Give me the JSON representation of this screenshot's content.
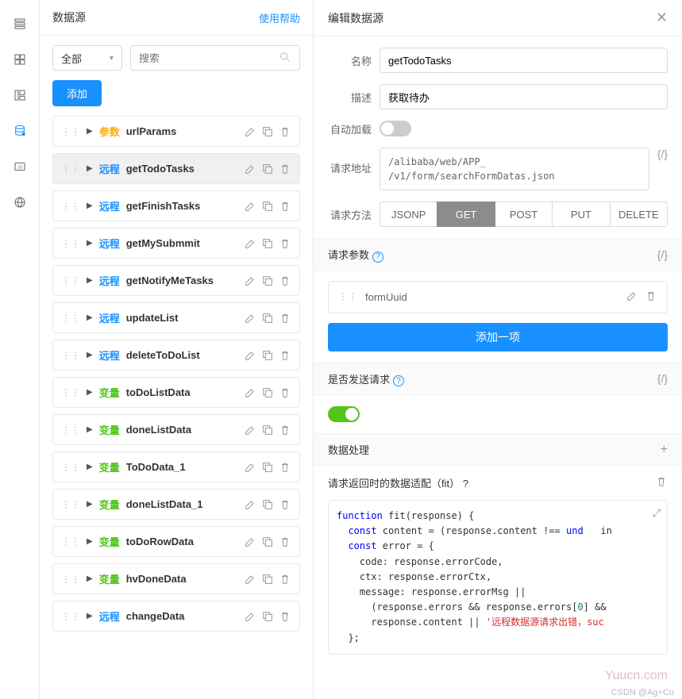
{
  "leftPanel": {
    "title": "数据源",
    "helpLink": "使用帮助",
    "filterAll": "全部",
    "searchPlaceholder": "搜索",
    "addBtn": "添加"
  },
  "dataSources": [
    {
      "type": "param",
      "typeLabel": "参数",
      "name": "urlParams",
      "selected": false
    },
    {
      "type": "remote",
      "typeLabel": "远程",
      "name": "getTodoTasks",
      "selected": true
    },
    {
      "type": "remote",
      "typeLabel": "远程",
      "name": "getFinishTasks",
      "selected": false
    },
    {
      "type": "remote",
      "typeLabel": "远程",
      "name": "getMySubmmit",
      "selected": false
    },
    {
      "type": "remote",
      "typeLabel": "远程",
      "name": "getNotifyMeTasks",
      "selected": false
    },
    {
      "type": "remote",
      "typeLabel": "远程",
      "name": "updateList",
      "selected": false
    },
    {
      "type": "remote",
      "typeLabel": "远程",
      "name": "deleteToDoList",
      "selected": false
    },
    {
      "type": "var",
      "typeLabel": "变量",
      "name": "toDoListData",
      "selected": false
    },
    {
      "type": "var",
      "typeLabel": "变量",
      "name": "doneListData",
      "selected": false
    },
    {
      "type": "var",
      "typeLabel": "变量",
      "name": "ToDoData_1",
      "selected": false
    },
    {
      "type": "var",
      "typeLabel": "变量",
      "name": "doneListData_1",
      "selected": false
    },
    {
      "type": "var",
      "typeLabel": "变量",
      "name": "toDoRowData",
      "selected": false
    },
    {
      "type": "var",
      "typeLabel": "变量",
      "name": "hvDoneData",
      "selected": false
    },
    {
      "type": "remote",
      "typeLabel": "远程",
      "name": "changeData",
      "selected": false
    }
  ],
  "rightPanel": {
    "title": "编辑数据源",
    "labels": {
      "name": "名称",
      "desc": "描述",
      "autoLoad": "自动加载",
      "reqUrl": "请求地址",
      "reqMethod": "请求方法",
      "reqParams": "请求参数",
      "sendReq": "是否发送请求",
      "dataHandle": "数据处理",
      "fitLabel": "请求返回时的数据适配（fit）"
    },
    "values": {
      "name": "getTodoTasks",
      "desc": "获取待办",
      "url": "/alibaba/web/APP_                                         /v1/form/searchFormDatas.json",
      "paramName": "formUuid",
      "addItemBtn": "添加一项"
    },
    "methods": [
      "JSONP",
      "GET",
      "POST",
      "PUT",
      "DELETE"
    ],
    "activeMethod": "GET"
  },
  "code": {
    "l1a": "function",
    "l1b": " fit(response) {",
    "l2a": "  const",
    "l2b": " content = (response.content !== ",
    "l2c": "und",
    "l2d": "in",
    "l3a": "  const",
    "l3b": " error = {",
    "l4": "    code: response.errorCode,",
    "l5": "    ctx: response.errorCtx,",
    "l6": "    message: response.errorMsg ||",
    "l7a": "      (response.errors && response.errors[",
    "l7b": "0",
    "l7c": "] &&",
    "l8a": "      response.content || ",
    "l8b": "'远程数据源请求出错，suc",
    "l9": "  };"
  },
  "watermark": "Yuucn.com",
  "footerMark": "CSDN @Ag+Cu"
}
